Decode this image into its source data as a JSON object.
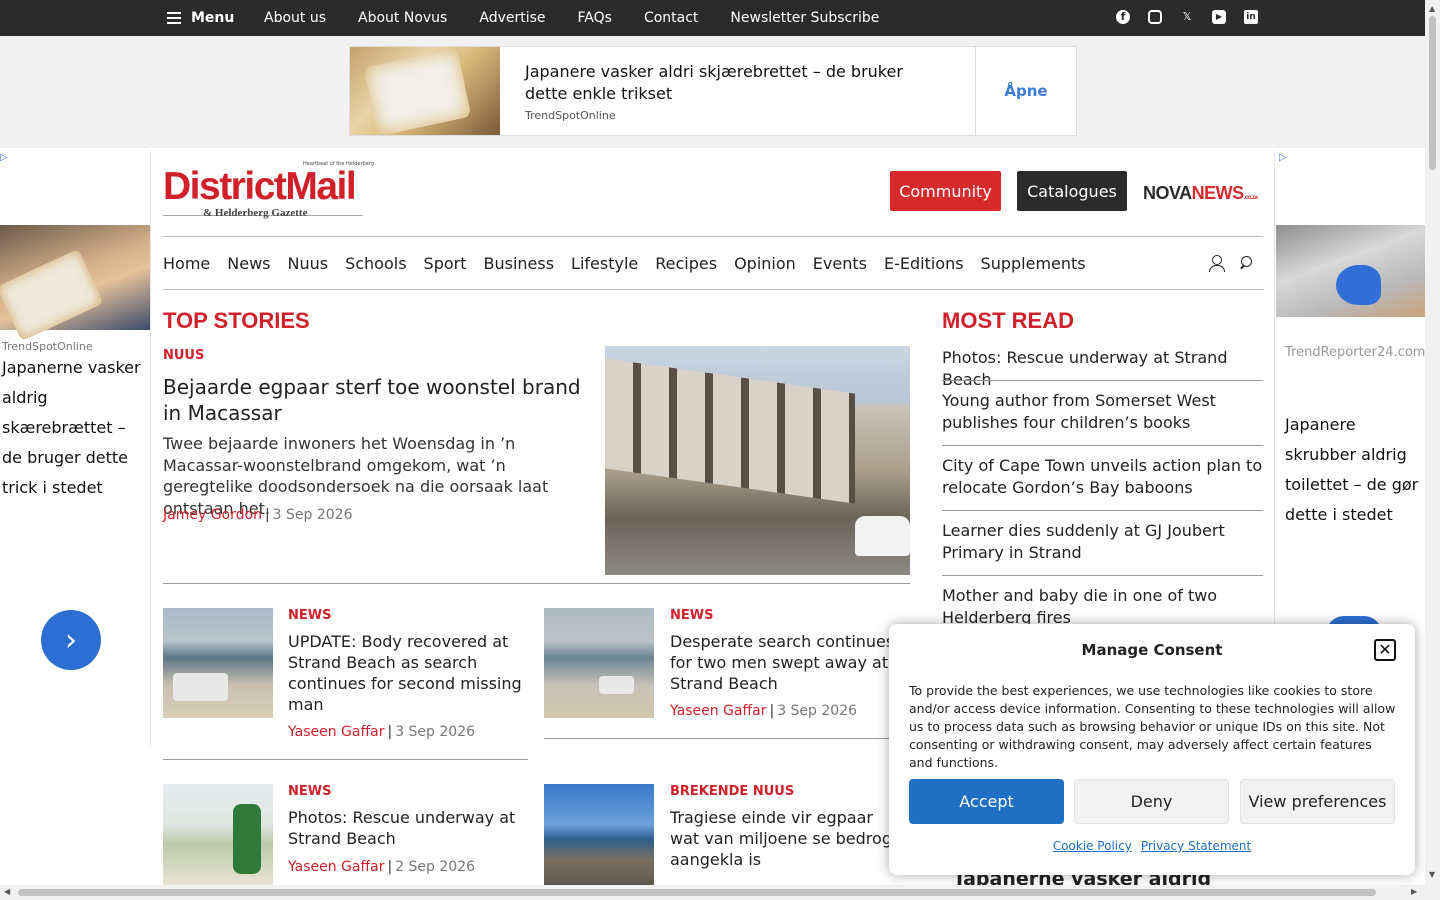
{
  "topbar": {
    "menu_label": "Menu",
    "links": [
      "About us",
      "About Novus",
      "Advertise",
      "FAQs",
      "Contact",
      "Newsletter Subscribe"
    ],
    "social_icons": [
      "facebook-icon",
      "instagram-icon",
      "x-icon",
      "youtube-icon",
      "linkedin-icon"
    ]
  },
  "top_ad": {
    "headline": "Japanere vasker aldri skjærebrettet – de bruker dette enkle trikset",
    "source": "TrendSpotOnline",
    "cta": "Åpne"
  },
  "left_ad": {
    "source": "TrendSpotOnline",
    "text": "Japanerne vasker aldrig skærebrættet – de bruger dette trick i stedet"
  },
  "right_ad": {
    "source": "TrendReporter24.com",
    "text": "Japanere skrubber aldrig toilettet – de gør dette i stedet"
  },
  "logo": {
    "tagline": "Heartbeat of the Helderberg",
    "name": "DistrictMail",
    "subtitle": "& Helderberg Gazette"
  },
  "header_buttons": {
    "community": "Community",
    "catalogues": "Catalogues"
  },
  "novanews": {
    "part1": "NOVA",
    "part2": "NEWS",
    "part3": ".co.za"
  },
  "nav": {
    "items": [
      "Home",
      "News",
      "Nuus",
      "Schools",
      "Sport",
      "Business",
      "Lifestyle",
      "Recipes",
      "Opinion",
      "Events",
      "E-Editions",
      "Supplements"
    ]
  },
  "top_stories": {
    "heading": "TOP STORIES",
    "lead": {
      "kicker": "NUUS",
      "title": "Bejaarde egpaar sterf toe woonstel brand in Macassar",
      "description": "Twee bejaarde inwoners het Woensdag in ’n Macassar-woonstelbrand omgekom, wat ’n geregtelike doodsondersoek na die oorsaak laat ontstaan het.",
      "author": "Jamey Gordon",
      "date": "3 Sep 2026"
    },
    "cards": [
      {
        "kicker": "NEWS",
        "title": "UPDATE: Body recovered at Strand Beach as search continues for second missing man",
        "author": "Yaseen Gaffar",
        "date": "3 Sep 2026"
      },
      {
        "kicker": "NEWS",
        "title": "Desperate search continues for two men swept away at Strand Beach",
        "author": "Yaseen Gaffar",
        "date": "3 Sep 2026"
      },
      {
        "kicker": "NEWS",
        "title": "Photos: Rescue underway at Strand Beach",
        "author": "Yaseen Gaffar",
        "date": "2 Sep 2026"
      },
      {
        "kicker": "BREKENDE NUUS",
        "title": "Tragiese einde vir egpaar wat van miljoene se bedrog aangekla is"
      }
    ]
  },
  "most_read": {
    "heading": "MOST READ",
    "items": [
      "Photos: Rescue underway at Strand Beach",
      "Young author from Somerset West publishes four children’s books",
      "City of Cape Town unveils action plan to relocate Gordon’s Bay baboons",
      "Learner dies suddenly at GJ Joubert Primary in Strand",
      "Mother and baby die in one of two Helderberg fires"
    ],
    "partial_below": "Japanerne vasker aldrig"
  },
  "consent": {
    "title": "Manage Consent",
    "body": "To provide the best experiences, we use technologies like cookies to store and/or access device information. Consenting to these technologies will allow us to process data such as browsing behavior or unique IDs on this site. Not consenting or withdrawing consent, may adversely affect certain features and functions.",
    "accept": "Accept",
    "deny": "Deny",
    "preferences": "View preferences",
    "cookie_policy": "Cookie Policy",
    "privacy_statement": "Privacy Statement"
  },
  "colors": {
    "brand_red": "#d0202a",
    "topbar_bg": "#2b2b2b",
    "accept_blue": "#1f6fc4"
  }
}
